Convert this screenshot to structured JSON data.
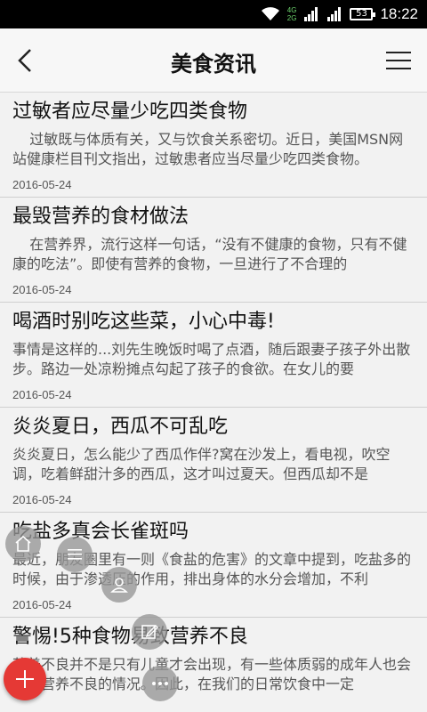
{
  "status_bar": {
    "network_label": "4G",
    "network_label2": "2G",
    "battery": "53",
    "time": "18:22"
  },
  "nav": {
    "title": "美食资讯",
    "back_icon": "chevron-left-icon",
    "menu_icon": "hamburger-menu-icon"
  },
  "articles": [
    {
      "title": "过敏者应尽量少吃四类食物",
      "summary": "过敏既与体质有关，又与饮食关系密切。近日，美国MSN网站健康栏目刊文指出，过敏患者应当尽量少吃四类食物。",
      "date": "2016-05-24"
    },
    {
      "title": "最毁营养的食材做法",
      "summary": "在营养界，流行这样一句话，“没有不健康的食物，只有不健康的吃法”。即使有营养的食物，一旦进行了不合理的",
      "date": "2016-05-24"
    },
    {
      "title": "喝酒时别吃这些菜，小心中毒!",
      "summary": "事情是这样的...刘先生晚饭时喝了点酒，随后跟妻子孩子外出散步。路边一处凉粉摊点勾起了孩子的食欲。在女儿的要",
      "date": "2016-05-24"
    },
    {
      "title": "炎炎夏日，西瓜不可乱吃",
      "summary": "炎炎夏日，怎么能少了西瓜作伴?窝在沙发上，看电视，吹空调，吃着鲜甜汁多的西瓜，这才叫过夏天。但西瓜却不是",
      "date": "2016-05-24"
    },
    {
      "title": "吃盐多真会长雀斑吗",
      "summary": "最近，朋友圈里有一则《食盐的危害》的文章中提到，吃盐多的时候，由于渗透压的作用，排出身体的水分会增加，不利",
      "date": "2016-05-24"
    },
    {
      "title": "警惕!5种食物易致营养不良",
      "summary": "营养不良并不是只有儿童才会出现，有一些体质弱的成年人也会出现营养不良的情况。因此，在我们的日常饮食中一定",
      "date": ""
    }
  ],
  "floating_menu": {
    "main_button_icon": "plus-icon",
    "items": [
      "home-icon",
      "list-icon",
      "user-icon",
      "edit-icon",
      "more-icon"
    ]
  },
  "colors": {
    "accent": "#e53935",
    "background": "#f2f2f2",
    "nav_background": "#f7f7f7"
  }
}
